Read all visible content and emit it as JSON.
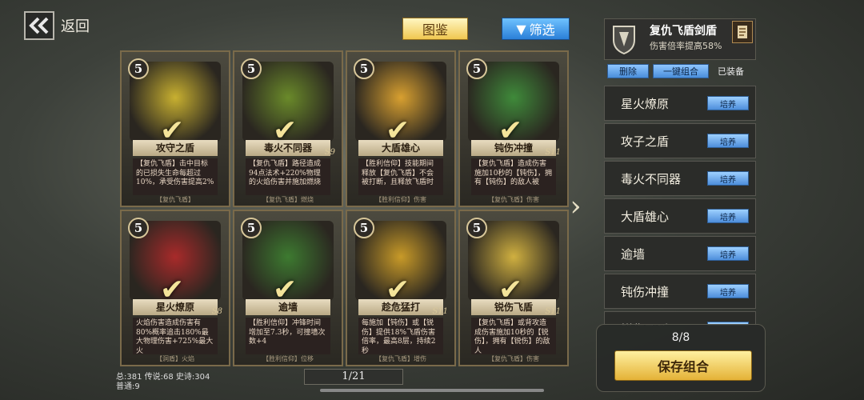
{
  "nav": {
    "back_label": "返回"
  },
  "toolbar": {
    "tujian_label": "图鉴",
    "filter_label": "筛选",
    "filter_icon": "▼"
  },
  "cards": [
    {
      "cost": "5",
      "name": "攻守之盾",
      "tag": "",
      "desc": "【复仇飞盾】击中目标的已损失生命每超过10%，承受伤害提高2%",
      "foot": "【复仇飞盾】",
      "art": "#c8b030"
    },
    {
      "cost": "5",
      "name": "毒火不同器",
      "tag": "S9",
      "desc": "【复仇飞盾】路径造成94点法术+220%物理的火焰伤害并施加燃烧",
      "foot": "【复仇飞盾】燃烧",
      "art": "#6a8a2a"
    },
    {
      "cost": "5",
      "name": "大盾雄心",
      "tag": "",
      "desc": "【胜利信仰】技能期间释放【复仇飞盾】不会被打断，且释放飞盾时",
      "foot": "【胜利信仰】伤害",
      "art": "#d8a030"
    },
    {
      "cost": "5",
      "name": "钝伤冲撞",
      "tag": "S11",
      "desc": "【复仇飞盾】造成伤害施加10秒的【钝伤】，拥有【钝伤】的敌人被",
      "foot": "【复仇飞盾】伤害",
      "art": "#3f8a3a"
    },
    {
      "cost": "5",
      "name": "星火燎原",
      "tag": "S8",
      "desc": "火焰伤害造成伤害有80%概率追击180%最大物理伤害+725%最大火",
      "foot": "【洞盾】火焰",
      "art": "#a82a2a"
    },
    {
      "cost": "5",
      "name": "逾墙",
      "tag": "",
      "desc": "【胜利信仰】冲锋时间增加至7.3秒，可撞墙次数+4",
      "foot": "【胜利信仰】位移",
      "art": "#3d7a30"
    },
    {
      "cost": "5",
      "name": "趁危猛打",
      "tag": "S11",
      "desc": "每施加【钝伤】或【锐伤】提供18%飞盾伤害倍率，最高8层，持续2秒",
      "foot": "【复仇飞盾】增伤",
      "art": "#c89a28"
    },
    {
      "cost": "5",
      "name": "锐伤飞盾",
      "tag": "S11",
      "desc": "【复仇飞盾】或背攻造成伤害施加10秒的【锐伤】，拥有【锐伤】的敌人",
      "foot": "【复仇飞盾】伤害",
      "art": "#d0b040"
    }
  ],
  "summary": {
    "line1": "总:381 传说:68 史诗:304",
    "line2": "普通:9"
  },
  "pager": {
    "text": "1/21"
  },
  "panel": {
    "title": "复仇飞盾剑盾",
    "subtitle": "伤害倍率提高58%",
    "delete_label": "删除",
    "combo_label": "一键组合",
    "equipped_label": "已装备",
    "items": [
      {
        "label": "星火燎原",
        "button": "培养"
      },
      {
        "label": "攻子之盾",
        "button": "培养"
      },
      {
        "label": "毒火不同器",
        "button": "培养"
      },
      {
        "label": "大盾雄心",
        "button": "培养"
      },
      {
        "label": "逾墙",
        "button": "培养"
      },
      {
        "label": "钝伤冲撞",
        "button": "培养"
      },
      {
        "label": "锐伤飞盾",
        "button": "培养"
      }
    ],
    "count": "8/8",
    "save_label": "保存组合"
  },
  "colors": {
    "accent_gold": "#f0c750",
    "accent_blue": "#2a7fd8"
  }
}
